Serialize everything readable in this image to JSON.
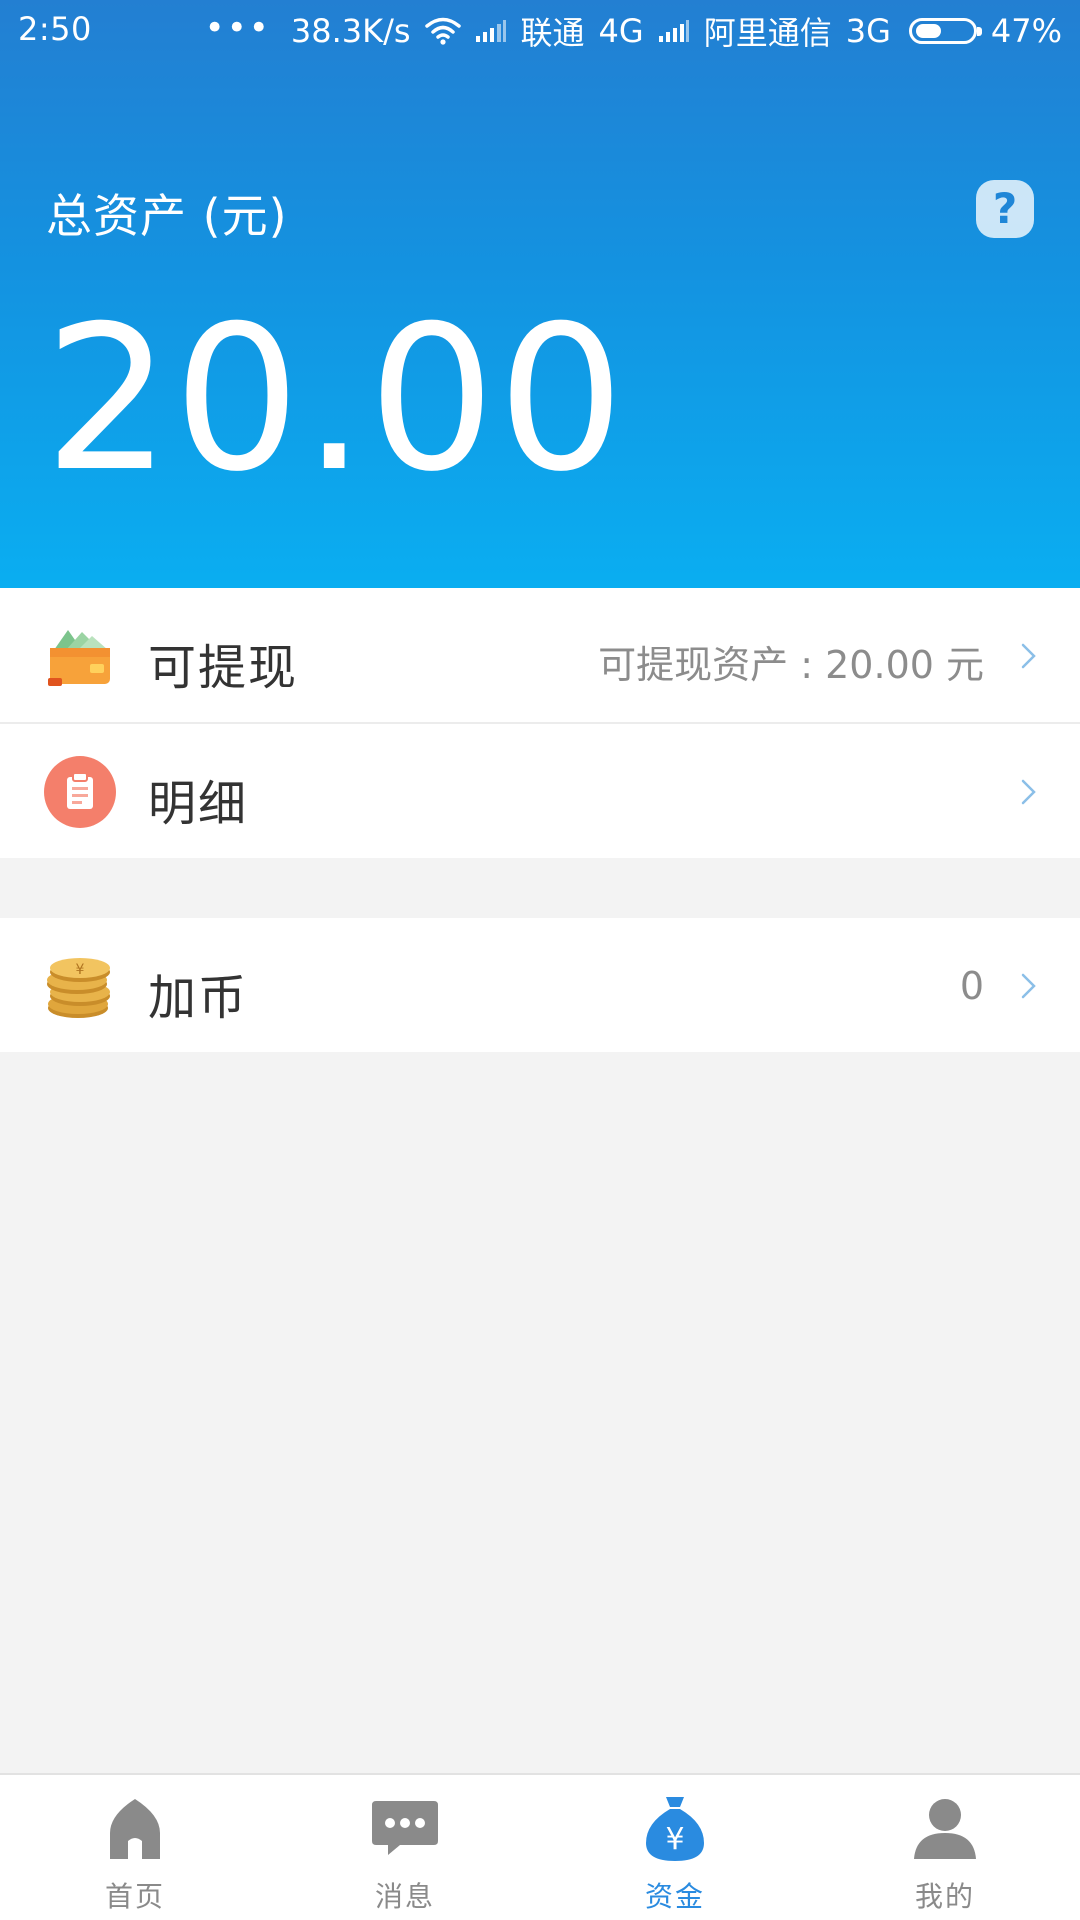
{
  "status_bar": {
    "time": "2:50",
    "dots": "•••",
    "net_speed": "38.3K/s",
    "carrier1": "联通",
    "network1": "4G",
    "carrier2": "阿里通信",
    "network2": "3G",
    "battery_percent": "47%",
    "battery_level": 0.47
  },
  "header": {
    "title": "总资产 (元)",
    "help_icon": "?",
    "amount": "20.00",
    "gradient_colors": [
      "#237fd2",
      "#0aaef1"
    ]
  },
  "rows": [
    {
      "icon": "wallet-icon",
      "label": "可提现",
      "value": "可提现资产 : 20.00 元"
    },
    {
      "icon": "clipboard-icon",
      "label": "明细",
      "value": ""
    },
    {
      "icon": "coins-icon",
      "label": "加币",
      "value": "0"
    }
  ],
  "bottom_nav": {
    "active_index": 2,
    "items": [
      {
        "icon": "home-icon",
        "label": "首页"
      },
      {
        "icon": "message-icon",
        "label": "消息"
      },
      {
        "icon": "money-bag-icon",
        "label": "资金"
      },
      {
        "icon": "profile-icon",
        "label": "我的"
      }
    ]
  },
  "colors": {
    "accent": "#2a8be0",
    "nav_inactive": "#8a8a8a",
    "background": "#f3f3f3"
  }
}
